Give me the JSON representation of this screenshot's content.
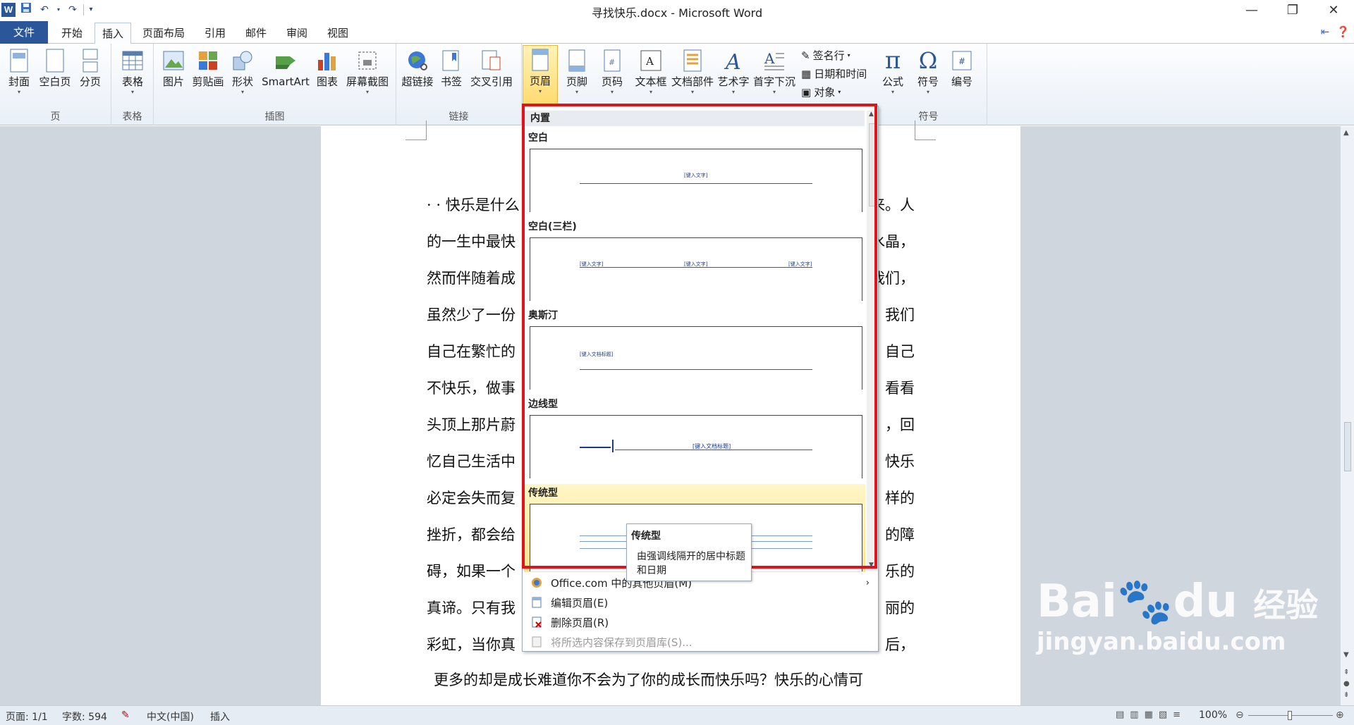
{
  "window": {
    "title": "寻找快乐.docx - Microsoft Word",
    "minimize": "—",
    "restore": "❐",
    "close": "✕"
  },
  "qat": {
    "logo": "W"
  },
  "tabs": [
    "文件",
    "开始",
    "插入",
    "页面布局",
    "引用",
    "邮件",
    "审阅",
    "视图"
  ],
  "ribbon": {
    "groups": {
      "page": "页",
      "table": "表格",
      "illustrations": "插图",
      "links": "链接",
      "symbols": "符号"
    },
    "buttons": {
      "cover": "封面",
      "blank": "空白页",
      "break": "分页",
      "table": "表格",
      "picture": "图片",
      "clipart": "剪贴画",
      "shapes": "形状",
      "smartart": "SmartArt",
      "chart": "图表",
      "screenshot": "屏幕截图",
      "hyperlink": "超链接",
      "bookmark": "书签",
      "crossref": "交叉引用",
      "header": "页眉",
      "footer": "页脚",
      "pagenum": "页码",
      "textbox": "文本框",
      "quickparts": "文档部件",
      "wordart": "艺术字",
      "dropcap": "首字下沉",
      "signature": "签名行",
      "datetime": "日期和时间",
      "object": "对象",
      "equation": "公式",
      "symbol": "符号",
      "number": "编号"
    }
  },
  "document": {
    "lines": [
      {
        "left": "· · 快乐是什么",
        "right": "来。人"
      },
      {
        "left": "的一生中最快",
        "right": "水晶，"
      },
      {
        "left": "然而伴随着成",
        "right": "我们，"
      },
      {
        "left": "虽然少了一份",
        "right": "我们"
      },
      {
        "left": "自己在繁忙的",
        "right": "自己"
      },
      {
        "left": "不快乐，做事",
        "right": "看看"
      },
      {
        "left": "头顶上那片蔚",
        "right": "，回"
      },
      {
        "left": "忆自己生活中",
        "right": "快乐"
      },
      {
        "left": "必定会失而复",
        "right": "样的"
      },
      {
        "left": "挫折，都会给",
        "right": "的障"
      },
      {
        "left": "碍，如果一个",
        "right": "乐的"
      },
      {
        "left": "真谛。只有我",
        "right": "丽的"
      },
      {
        "left": "彩虹，当你真",
        "right": "后，"
      }
    ],
    "last_line": "更多的却是成长难道你不会为了你的成长而快乐吗？快乐的心情可"
  },
  "gallery": {
    "header": "内置",
    "items": [
      {
        "title": "空白",
        "ph": [
          "[键入文字]"
        ]
      },
      {
        "title": "空白(三栏)",
        "ph": [
          "[键入文字]",
          "[键入文字]",
          "[键入文字]"
        ]
      },
      {
        "title": "奥斯汀",
        "ph": [
          "[键入文档标题]"
        ]
      },
      {
        "title": "边线型",
        "ph": [
          "[键入文档标题]"
        ]
      },
      {
        "title": "传统型",
        "ph": []
      }
    ],
    "tooltip": {
      "title": "传统型",
      "desc": "由强调线隔开的居中标题和日期"
    },
    "menu": [
      {
        "label": "Office.com 中的其他页眉(M)",
        "arrow": "›"
      },
      {
        "label": "编辑页眉(E)"
      },
      {
        "label": "删除页眉(R)"
      },
      {
        "label": "将所选内容保存到页眉库(S)..."
      }
    ]
  },
  "status": {
    "page": "页面: 1/1",
    "words": "字数: 594",
    "lang": "中文(中国)",
    "mode": "插入",
    "zoom": "100%"
  },
  "watermark": {
    "brand": "Bai",
    "du": "du",
    "cn": "经验",
    "url": "jingyan.baidu.com"
  },
  "colors": {
    "file_tab": "#2b579a",
    "highlight_box": "#e0121a",
    "hover": "#ffe38a"
  }
}
